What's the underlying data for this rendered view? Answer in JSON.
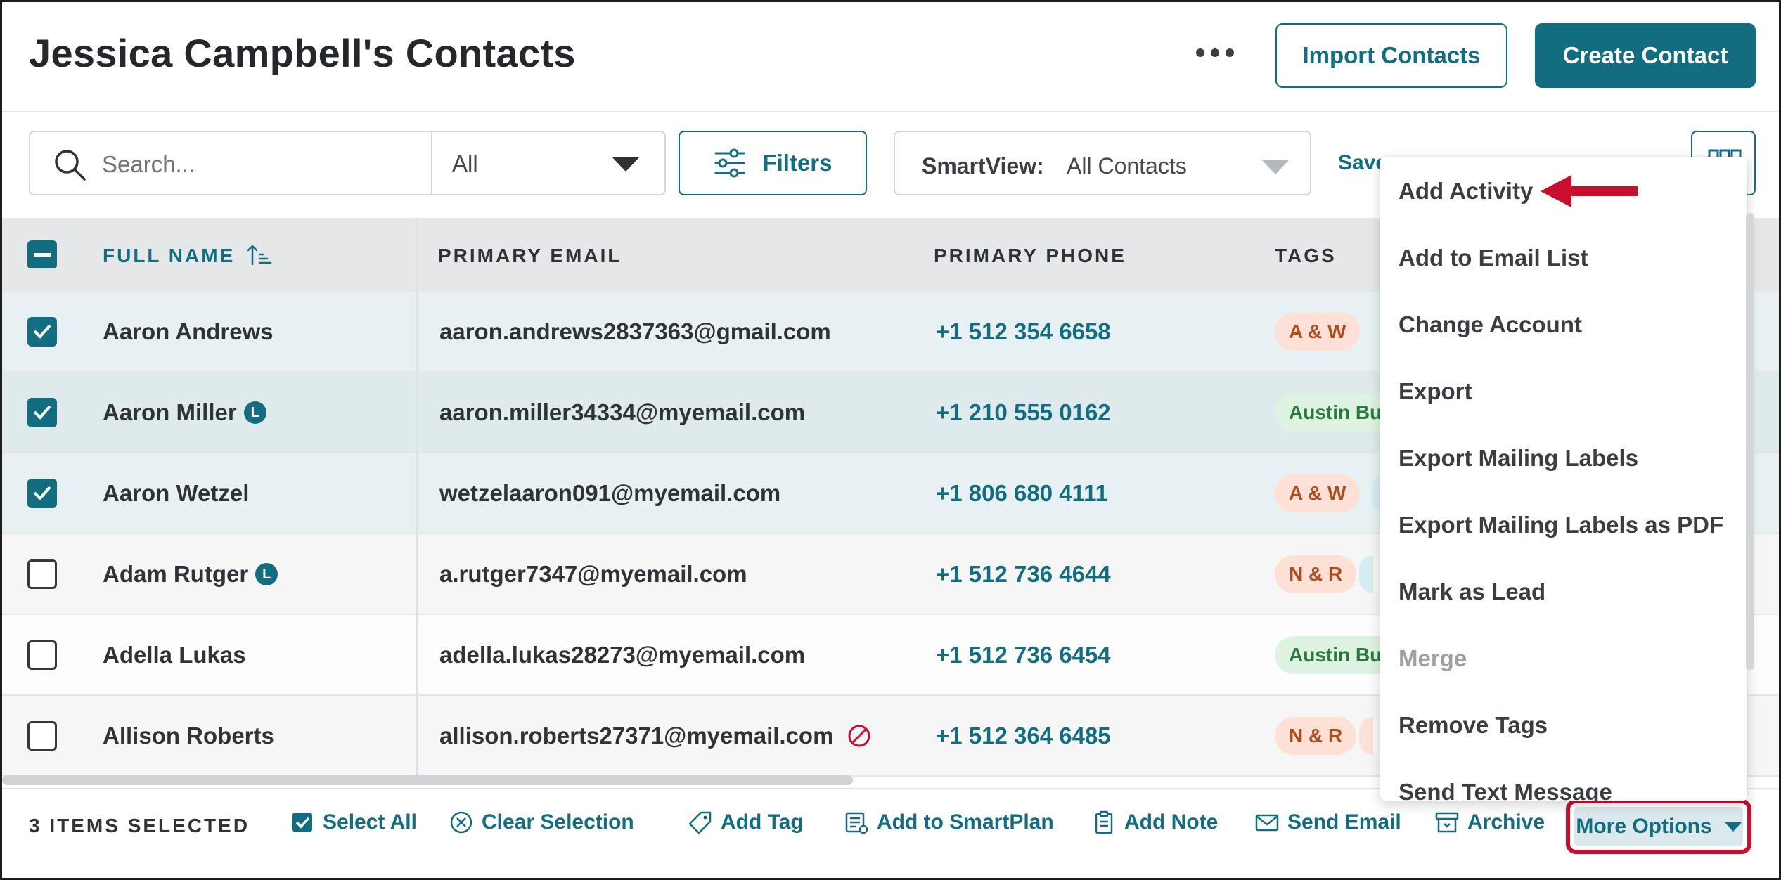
{
  "header": {
    "title": "Jessica Campbell's Contacts",
    "import_label": "Import Contacts",
    "create_label": "Create Contact"
  },
  "toolbar": {
    "search_placeholder": "Search...",
    "scope_value": "All",
    "filters_label": "Filters",
    "smartview_label": "SmartView:",
    "smartview_value": "All Contacts",
    "save_label": "Save"
  },
  "table": {
    "columns": {
      "name": "FULL NAME",
      "email": "PRIMARY EMAIL",
      "phone": "PRIMARY PHONE",
      "tags": "TAGS"
    },
    "rows": [
      {
        "name": "Aaron Andrews",
        "lead": "",
        "email": "aaron.andrews2837363@gmail.com",
        "phone": "+1 512 354 6658",
        "tag": "A & W",
        "checked": true
      },
      {
        "name": "Aaron Miller",
        "lead": "L",
        "email": "aaron.miller34334@myemail.com",
        "phone": "+1 210 555 0162",
        "tag": "Austin Bu",
        "checked": true
      },
      {
        "name": "Aaron Wetzel",
        "lead": "",
        "email": "wetzelaaron091@myemail.com",
        "phone": "+1 806 680 4111",
        "tag": "A & W",
        "checked": true
      },
      {
        "name": "Adam Rutger",
        "lead": "L",
        "email": "a.rutger7347@myemail.com",
        "phone": "+1 512 736 4644",
        "tag": "N & R",
        "checked": false
      },
      {
        "name": "Adella Lukas",
        "lead": "",
        "email": "adella.lukas28273@myemail.com",
        "phone": "+1 512 736 6454",
        "tag": "Austin Bu",
        "checked": false
      },
      {
        "name": "Allison Roberts",
        "lead": "",
        "email": "allison.roberts27371@myemail.com",
        "phone": "+1 512 364 6485",
        "tag": "N & R",
        "checked": false
      }
    ]
  },
  "bottom_bar": {
    "items_selected": "3 ITEMS SELECTED",
    "select_all": "Select All",
    "clear_selection": "Clear Selection",
    "add_tag": "Add Tag",
    "add_smartplan": "Add to SmartPlan",
    "add_note": "Add Note",
    "send_email": "Send Email",
    "archive": "Archive",
    "more_options": "More Options"
  },
  "menu": {
    "items": [
      {
        "label": "Add Activity",
        "disabled": false
      },
      {
        "label": "Add to Email List",
        "disabled": false
      },
      {
        "label": "Change Account",
        "disabled": false
      },
      {
        "label": "Export",
        "disabled": false
      },
      {
        "label": "Export Mailing Labels",
        "disabled": false
      },
      {
        "label": "Export Mailing Labels as PDF",
        "disabled": false
      },
      {
        "label": "Mark as Lead",
        "disabled": false
      },
      {
        "label": "Merge",
        "disabled": true
      },
      {
        "label": "Remove Tags",
        "disabled": false
      },
      {
        "label": "Send Text Message",
        "disabled": false
      }
    ]
  },
  "colors": {
    "accent": "#136d80",
    "highlight": "#c8102e"
  }
}
